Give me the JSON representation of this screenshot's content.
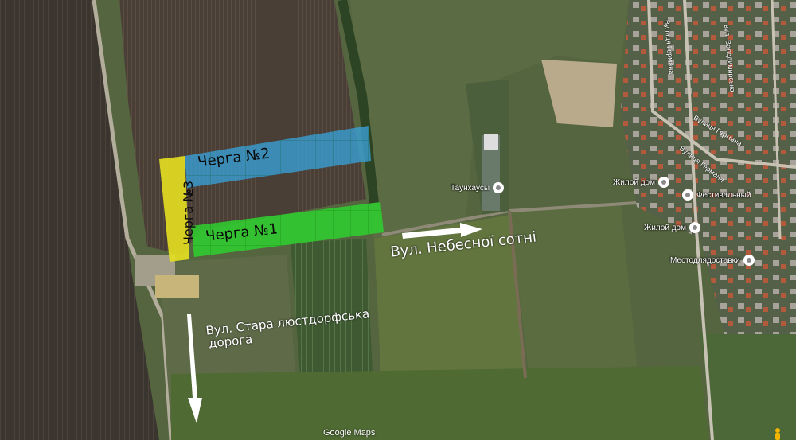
{
  "zones": {
    "queue1": {
      "label": "Черга №1",
      "color": "#2fd12f"
    },
    "queue2": {
      "label": "Черга №2",
      "color": "#39a0d8"
    },
    "queue3": {
      "label": "Черга №3",
      "color": "#e6e020"
    }
  },
  "streets": {
    "nebesnoi": "Вул. Небесної сотні",
    "stara_line1": "Вул. Стара люстдорфська",
    "stara_line2": "дорога",
    "germana": "Вулиця Германа",
    "germana2": "Вулиця Германа",
    "germana3": "Вулиця Германа",
    "volodymyrska": "вул. Володимирська"
  },
  "pois": {
    "taunhaus": "Таунхаусы",
    "zhiloy1": "Жилой дом",
    "festivalny": "Фестивальный",
    "zhiloy2": "Жилой дом",
    "mestodlyadostavki": "Местодлядоставки"
  },
  "attribution": "Google Maps",
  "icons": {
    "poi": "map-pin-icon",
    "pegman": "pegman-icon",
    "arrow": "arrow-icon"
  }
}
